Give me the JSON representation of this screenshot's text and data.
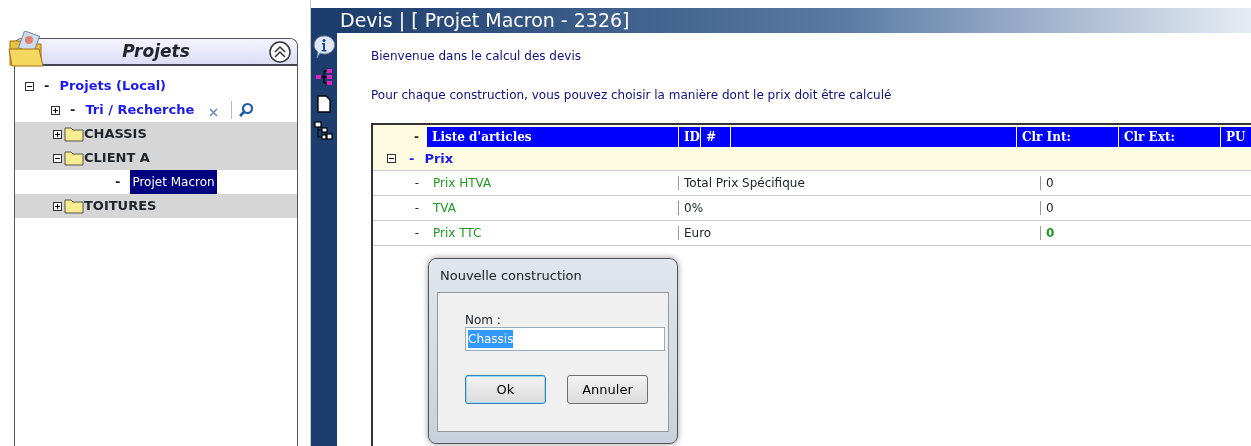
{
  "sidebar": {
    "title": "Projets"
  },
  "tree": [
    {
      "label": "Projets (Local)",
      "kind": "root",
      "marker": "-",
      "expanded": true,
      "selected": false,
      "children": [
        {
          "label": "Tri / Recherche",
          "kind": "search",
          "marker": "-",
          "expanded": false,
          "selected": false
        },
        {
          "label": "CHASSIS",
          "kind": "folder",
          "expanded": false,
          "selected": false
        },
        {
          "label": "CLIENT A",
          "kind": "folder",
          "expanded": true,
          "selected": false,
          "children": [
            {
              "label": "Projet Macron",
              "kind": "item",
              "marker": "-",
              "selected": true
            }
          ]
        },
        {
          "label": "TOITURES",
          "kind": "folder",
          "expanded": false,
          "selected": false
        }
      ]
    }
  ],
  "header": {
    "title": "Devis | [ Projet Macron - 2326]"
  },
  "intro": [
    "Bienvenue dans le calcul des devis",
    "Pour chaque construction, vous pouvez choisir la manière dont le prix doit être calculé"
  ],
  "table": {
    "marker": "-",
    "columns": [
      "Liste d'articles",
      "ID",
      "#",
      "Clr Int:",
      "Clr Ext:",
      "PU"
    ],
    "groups": [
      {
        "label": "Prix",
        "marker": "-",
        "expanded": true,
        "rows": [
          {
            "marker": "-",
            "label": "Prix HTVA",
            "id": "Total Prix Spécifique",
            "clr_int": "0",
            "total": false
          },
          {
            "marker": "-",
            "label": "TVA",
            "id": "0%",
            "clr_int": "0",
            "total": false
          },
          {
            "marker": "-",
            "label": "Prix TTC",
            "id": "Euro",
            "clr_int": "0",
            "total": true
          }
        ]
      }
    ]
  },
  "dialog": {
    "title": "Nouvelle construction",
    "field_label": "Nom :",
    "value": "Chassis",
    "buttons": [
      {
        "label": "Ok",
        "default": true
      },
      {
        "label": "Annuler",
        "default": false
      }
    ]
  }
}
